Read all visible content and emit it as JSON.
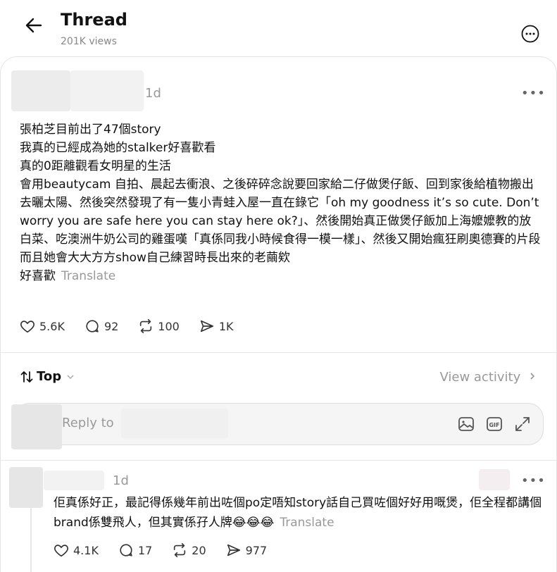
{
  "header": {
    "title": "Thread",
    "views": "201K views"
  },
  "post": {
    "time": "1d",
    "text": "張柏芝目前出了47個story\n我真的已經成為她的stalker好喜歡看\n真的0距離觀看女明星的生活\n會用beautycam 自拍、晨起去衝浪、之後碎碎念說要回家給二仔做煲仔飯、回到家後給植物搬出去曬太陽、然後突然發現了有一隻小青蛙入屋一直在錄它「oh my goodness it’s so cute. Don’t worry you are safe here you can stay here ok?」、然後開始真正做煲仔飯加上海嬤嬤教的放白菜、吃澳洲牛奶公司的雞蛋嘆「真係同我小時候食得一模一樣」、然後又開始瘋狂刷奧德賽的片段\n而且她會大大方方show自己練習時長出來的老繭欸\n好喜歡",
    "translate": "Translate",
    "likes": "5.6K",
    "comments": "92",
    "reposts": "100",
    "shares": "1K"
  },
  "sort": {
    "label": "Top",
    "view_activity": "View activity"
  },
  "reply": {
    "placeholder": "Reply to"
  },
  "comment": {
    "time": "1d",
    "text": "佢真係好正，最記得係幾年前出咗個po定唔知story話自己買咗個好好用嘅煲，佢全程都講個brand係雙飛人，但其實係孖人牌😂😂😂",
    "translate": "Translate",
    "likes": "4.1K",
    "comments": "17",
    "reposts": "20",
    "shares": "977"
  },
  "colors": {
    "text": "#111111",
    "muted": "#999999",
    "border": "#e3e3e3"
  }
}
